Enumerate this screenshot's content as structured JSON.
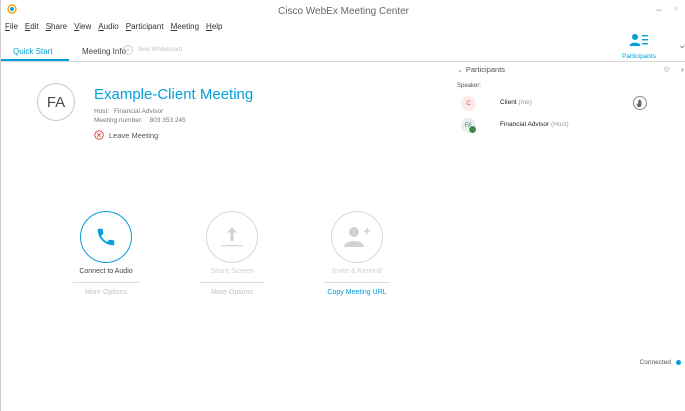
{
  "window": {
    "title": "Cisco WebEx Meeting Center",
    "minimize": "–",
    "maximize": "▫"
  },
  "menu": [
    {
      "first": "F",
      "rest": "ile"
    },
    {
      "first": "E",
      "rest": "dit"
    },
    {
      "first": "S",
      "rest": "hare"
    },
    {
      "first": "V",
      "rest": "iew"
    },
    {
      "first": "A",
      "rest": "udio"
    },
    {
      "first": "P",
      "rest": "articipant"
    },
    {
      "first": "M",
      "rest": "eeting"
    },
    {
      "first": "H",
      "rest": "elp"
    }
  ],
  "tabs": {
    "quick_start": "Quick Start",
    "meeting_info": "Meeting Info",
    "new_whiteboard": "New Whiteboard"
  },
  "toolbar": {
    "participants_label": "Participants",
    "expand_caret": "⌄"
  },
  "meeting": {
    "initials": "FA",
    "title": "Example-Client Meeting",
    "host_label": "Host:",
    "host_name": "Financial Advisor",
    "number_label": "Meeting number:",
    "number": "803 353 245",
    "leave_label": "Leave Meeting"
  },
  "actions": {
    "audio": {
      "label": "Connect to Audio",
      "option": "More Options"
    },
    "share": {
      "label": "Share Screen",
      "option": "More Options"
    },
    "invite": {
      "label": "Invite & Remind",
      "option": "Copy Meeting URL"
    }
  },
  "participants_panel": {
    "title": "Participants",
    "caret": "⌄",
    "gear": "⚙",
    "close": "›",
    "speaker_label": "Speaker:",
    "list": [
      {
        "initials": "C",
        "name": "Client",
        "role": "(me)"
      },
      {
        "initials": "FA",
        "name": "Financial Advisor",
        "role": "(Host)"
      }
    ]
  },
  "status": {
    "text": "Connected"
  },
  "colors": {
    "accent": "#049fd9",
    "leave_red": "#d9534f",
    "host_badge": "#3c8d4a"
  }
}
